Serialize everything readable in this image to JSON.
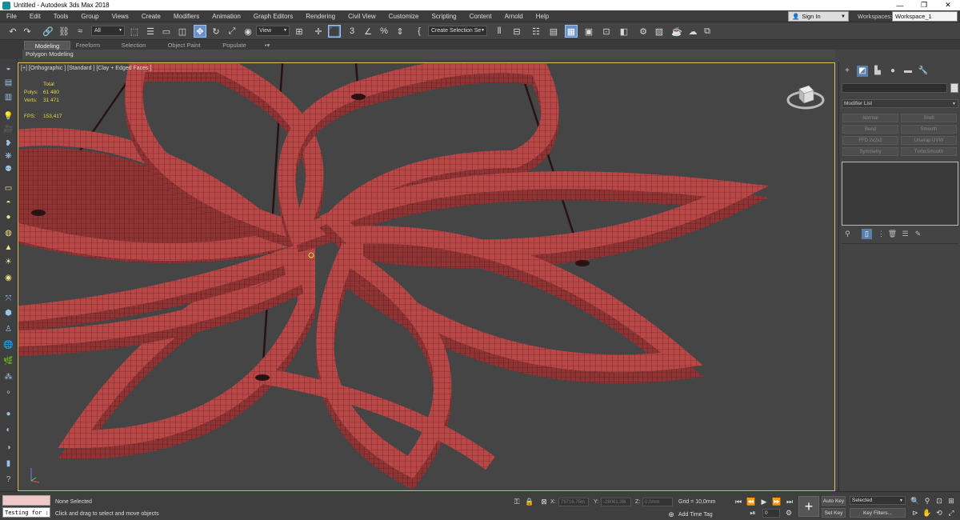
{
  "window": {
    "title": "Untitled - Autodesk 3ds Max 2018",
    "minimize": "—",
    "maximize": "❐",
    "close": "✕"
  },
  "menu": [
    "File",
    "Edit",
    "Tools",
    "Group",
    "Views",
    "Create",
    "Modifiers",
    "Animation",
    "Graph Editors",
    "Rendering",
    "Civil View",
    "Customize",
    "Scripting",
    "Content",
    "Arnold",
    "Help"
  ],
  "account": {
    "sign_in": "Sign In",
    "workspaces_label": "Workspaces:",
    "workspace_value": "Workspace_1"
  },
  "toolbar": {
    "selection_filter": "All",
    "ref_coord": "View",
    "named_selection": "Create Selection Se"
  },
  "ribbon": {
    "tabs": [
      "Modeling",
      "Freeform",
      "Selection",
      "Object Paint",
      "Populate"
    ],
    "subpanel": "Polygon Modeling"
  },
  "viewport": {
    "label": "[+] [Orthographic ] [Standard ] [Clay + Edged Faces ]",
    "stats": {
      "total_label": "Total",
      "polys_label": "Polys:",
      "polys_value": "61 480",
      "verts_label": "Verts:",
      "verts_value": "31 471",
      "fps_label": "FPS:",
      "fps_value": "153,417"
    },
    "colors": {
      "mesh": "#b84848",
      "mesh_wire": "#5a1a1a",
      "background": "#454545",
      "active_border": "#e0c060"
    }
  },
  "command_panel": {
    "modifier_list": "Modifier List",
    "modifier_buttons": [
      "Normal",
      "Shell",
      "Bend",
      "Smooth",
      "FFD 2x2x2",
      "Unwrap UVW",
      "Symmetry",
      "TurboSmooth"
    ]
  },
  "status": {
    "maxscript_input": "Testing for :",
    "selection": "None Selected",
    "prompt": "Click and drag to select and move objects",
    "x_label": "X:",
    "x_value": "79716,75m",
    "y_label": "Y:",
    "y_value": "-28061,38i",
    "z_label": "Z:",
    "z_value": "0,0mm",
    "grid": "Grid = 10,0mm",
    "add_time_tag": "Add Time Tag",
    "auto_key": "Auto Key",
    "set_key": "Set Key",
    "key_mode": "Selected",
    "key_filters": "Key Filters...",
    "frame": "0"
  }
}
